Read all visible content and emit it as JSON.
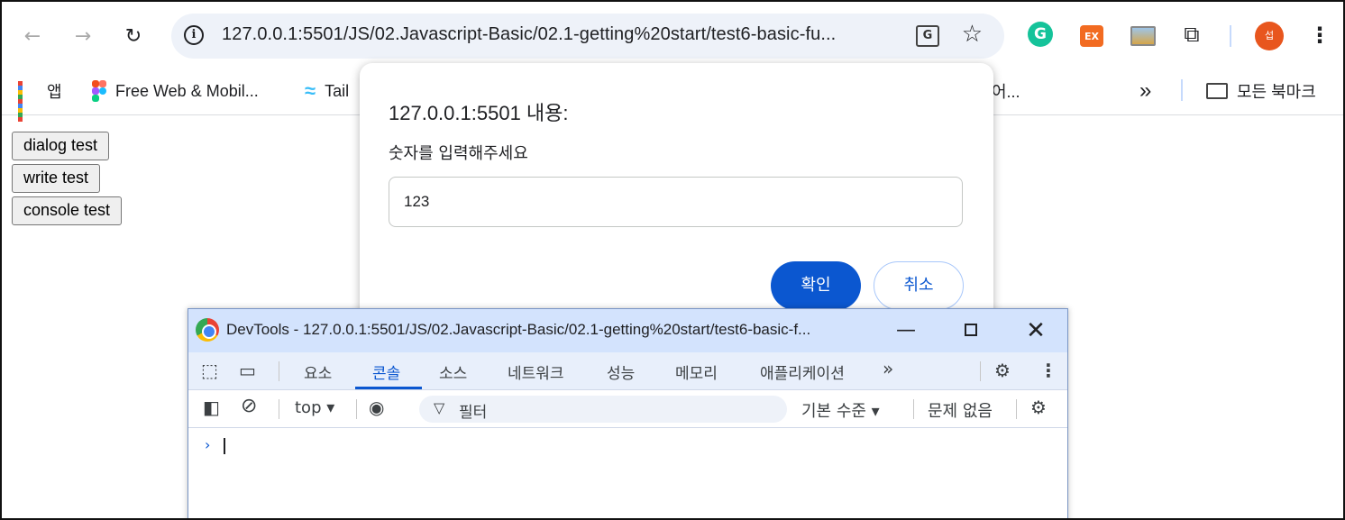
{
  "browser": {
    "url": "127.0.0.1:5501/JS/02.Javascript-Basic/02.1-getting%20start/test6-basic-fu...",
    "avatar_initial": "섭",
    "extensions": {
      "grammarly": "G",
      "ex": "EX"
    }
  },
  "bookmarks": {
    "items": [
      {
        "label": "앱"
      },
      {
        "label": "Free Web & Mobil..."
      },
      {
        "label": "Tail"
      },
      {
        "label": "어..."
      }
    ],
    "overflow": "»",
    "all_bookmarks": "모든 북마크"
  },
  "page": {
    "buttons": [
      {
        "label": "dialog test"
      },
      {
        "label": "write test"
      },
      {
        "label": "console test"
      }
    ]
  },
  "dialog": {
    "title": "127.0.0.1:5501 내용:",
    "message": "숫자를 입력해주세요",
    "input_value": "123",
    "ok_label": "확인",
    "cancel_label": "취소"
  },
  "devtools": {
    "title": "DevTools - 127.0.0.1:5501/JS/02.Javascript-Basic/02.1-getting%20start/test6-basic-f...",
    "tabs": [
      {
        "label": "요소"
      },
      {
        "label": "콘솔"
      },
      {
        "label": "소스"
      },
      {
        "label": "네트워크"
      },
      {
        "label": "성능"
      },
      {
        "label": "메모리"
      },
      {
        "label": "애플리케이션"
      }
    ],
    "more_tabs": "»",
    "context": "top ▾",
    "filter_placeholder": "필터",
    "level": "기본 수준 ▾",
    "issues": "문제 없음",
    "prompt": "›",
    "colors": {
      "accent": "#0b57d0",
      "titlebar": "#d3e3fd"
    }
  }
}
